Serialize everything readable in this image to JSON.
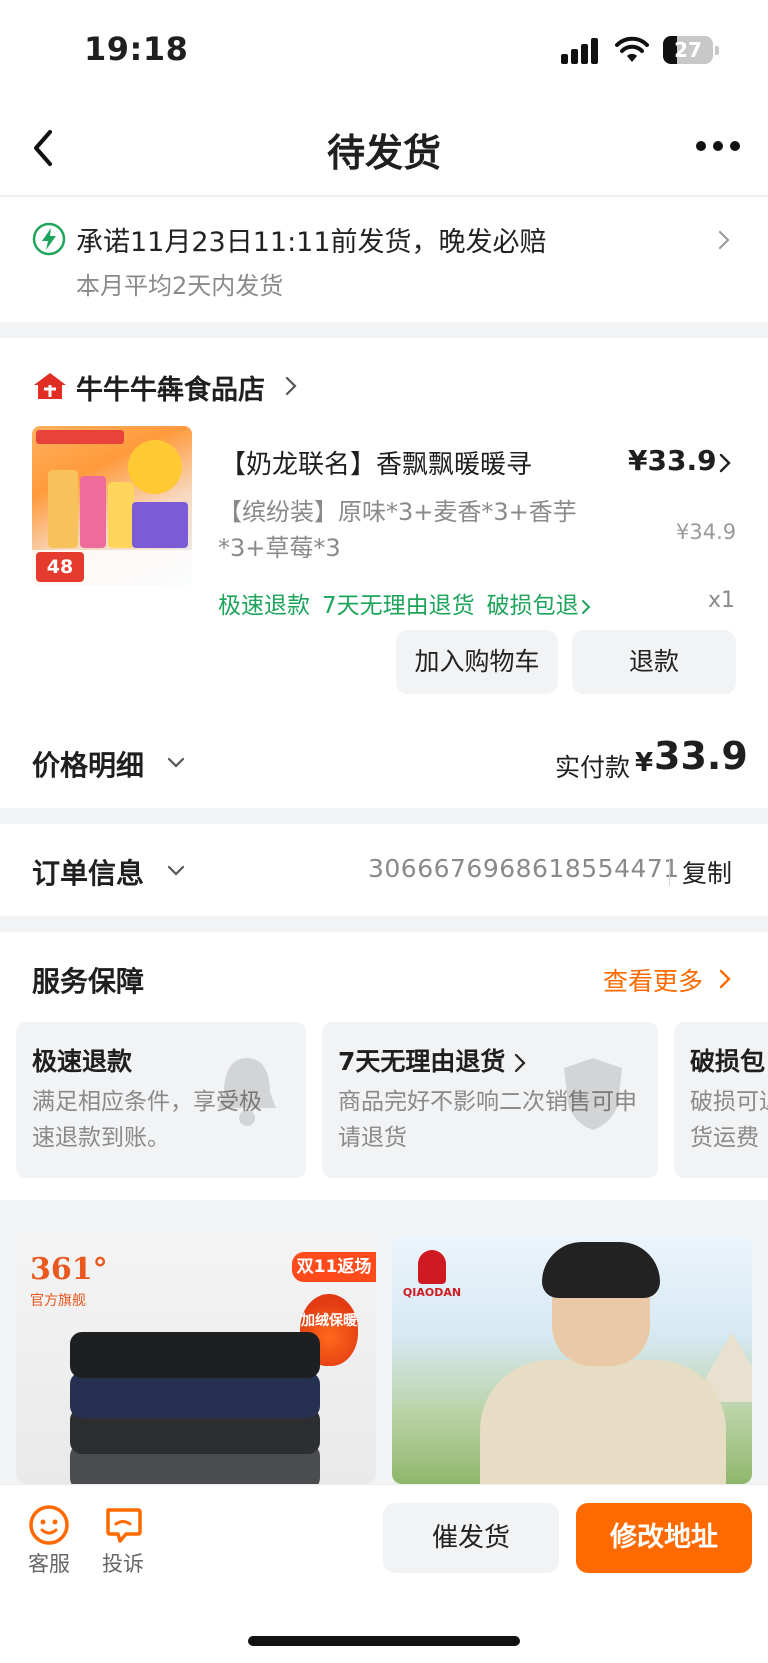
{
  "status_bar": {
    "time": "19:18",
    "battery": "27"
  },
  "nav": {
    "title": "待发货"
  },
  "promise": {
    "text": "承诺11月23日11:11前发货，晚发必赔",
    "subtext": "本月平均2天内发货"
  },
  "shop": {
    "name": "牛牛牛犇食品店"
  },
  "item": {
    "title": "【奶龙联名】香飘飘暖暖寻",
    "price": "¥33.9",
    "spec": "【缤纷装】原味*3+麦香*3+香芋*3+草莓*3",
    "original_price": "¥34.9",
    "quantity": "x1",
    "thumb_price": "48",
    "tags": [
      "极速退款",
      "7天无理由退货",
      "破损包退"
    ],
    "buttons": {
      "add_cart": "加入购物车",
      "refund": "退款"
    }
  },
  "price_detail": {
    "label": "价格明细",
    "paid_label": "实付款",
    "currency": "¥",
    "paid_amount": "33.9"
  },
  "order_info": {
    "label": "订单信息",
    "order_number": "3066676968618554471",
    "copy_label": "复制"
  },
  "service": {
    "title": "服务保障",
    "more_label": "查看更多",
    "cards": [
      {
        "title": "极速退款",
        "desc": "满足相应条件，享受极速退款到账。"
      },
      {
        "title": "7天无理由退货",
        "desc": "商品完好不影响二次销售可申请退货"
      },
      {
        "title": "破损包",
        "desc": "破损可退货运费"
      }
    ]
  },
  "recommend": [
    {
      "brand": "361°",
      "brand_sub": "官方旗舰",
      "badge": "双11返场",
      "feature": "加绒保暖"
    },
    {
      "brand": "QIAODAN"
    }
  ],
  "bottom_bar": {
    "service_label": "客服",
    "complaint_label": "投诉",
    "urge_label": "催发货",
    "address_label": "修改地址"
  },
  "colors": {
    "accent": "#ff6a00",
    "guarantee_green": "#1ea55b",
    "shop_red": "#e02e24"
  }
}
